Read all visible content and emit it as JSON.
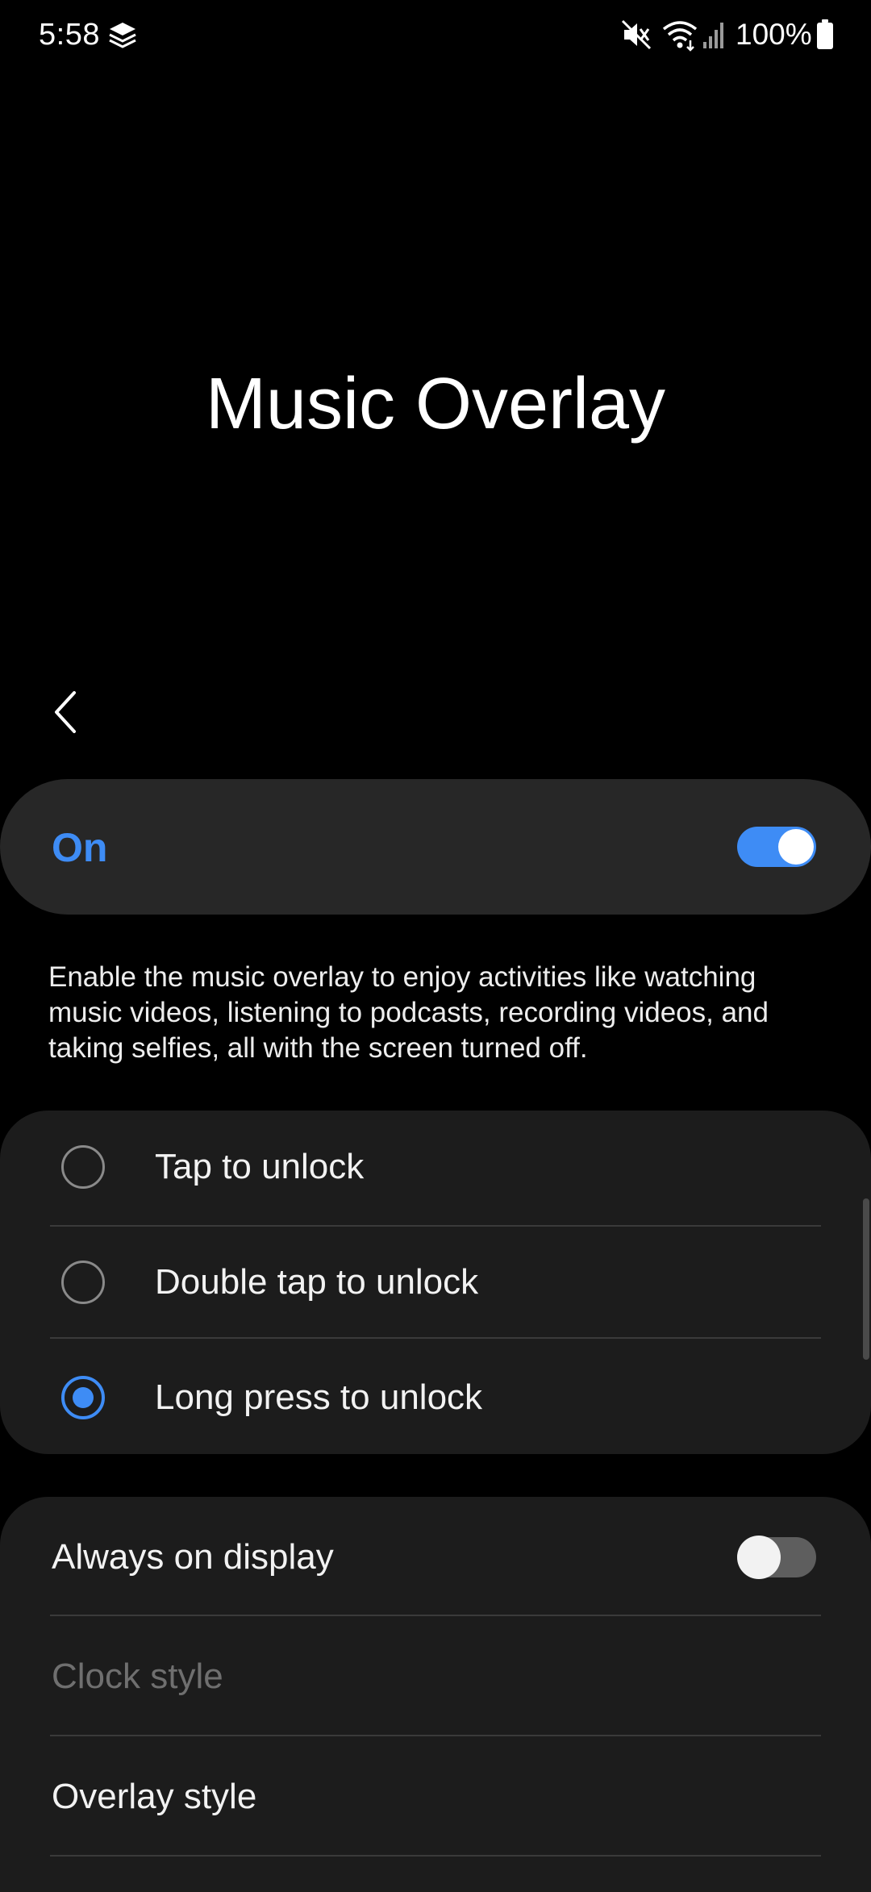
{
  "status_bar": {
    "time": "5:58",
    "battery": "100%",
    "icons": [
      "layers-icon",
      "mute-icon",
      "wifi-icon",
      "signal-icon",
      "battery-icon"
    ]
  },
  "header": {
    "title": "Music Overlay",
    "back_icon": "chevron-left-icon"
  },
  "master_switch": {
    "label": "On",
    "state": true
  },
  "description": "Enable the music overlay to enjoy activities like watching music videos, listening to podcasts, recording videos, and taking selfies, all with the screen turned off.",
  "unlock_options": [
    {
      "label": "Tap to unlock",
      "selected": false
    },
    {
      "label": "Double tap to unlock",
      "selected": false
    },
    {
      "label": "Long press to unlock",
      "selected": true
    }
  ],
  "settings": {
    "always_on_display": {
      "label": "Always on display",
      "state": false
    },
    "clock_style": {
      "label": "Clock style",
      "enabled": false
    },
    "overlay_style": {
      "label": "Overlay style"
    }
  },
  "colors": {
    "accent": "#3e8cf5",
    "background": "#000000",
    "card": "#1c1c1c",
    "master_card": "#272727"
  }
}
